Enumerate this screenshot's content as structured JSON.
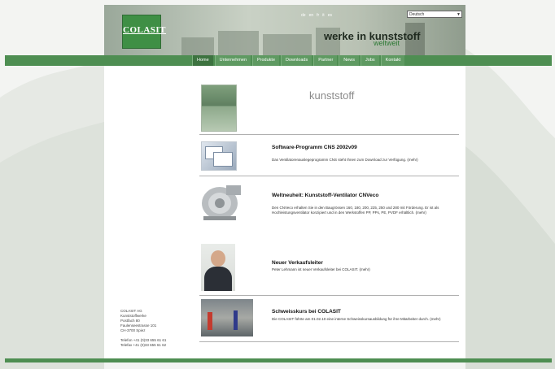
{
  "header": {
    "logo_text": "COLASIT",
    "tagline": "werke in kunststoff",
    "tagline_sub": "weltweit",
    "lang_links": [
      "de",
      "en",
      "fr",
      "it",
      "es"
    ],
    "language_select": "Deutsch"
  },
  "nav": {
    "items": [
      "Home",
      "Unternehmen",
      "Produkte",
      "Downloads",
      "Partner",
      "News",
      "Jobs",
      "Kontakt"
    ],
    "active_index": 0
  },
  "main": {
    "heading": "kunststoff",
    "items": [
      {
        "title": "Software-Programm CNS 2002v09",
        "text": "Das Ventilatorenauslegeprogramm CNS steht Ihnen zum Download zur Verfügung. (mehr)"
      },
      {
        "title": "Weltneuheit: Kunststoff-Ventilator CNVeco",
        "text": "Den CNVeco erhalten Sie in den Baugrössen 160, 180, 200, 225, 250 und 280 mit Förderung. Er ist als Hochleistungsventilator konzipiert und in den Werkstoffen PP, PPs, PE, PVDF erhältlich. (mehr)"
      },
      {
        "title": "Neuer Verkaufsleiter",
        "text": "Peter Lehmann ist neuer Verkaufsleiter bei COLASIT. (mehr)"
      },
      {
        "title": "Schweisskurs bei COLASIT",
        "text": "Die COLASIT führte am 01.02.10 eine interne Schweisskursausbildung für ihre Mitarbeiter durch. (mehr)"
      }
    ]
  },
  "address": {
    "lines": [
      "COLASIT AG",
      "Kunststoffwerke",
      "Postfach 80",
      "Faulenseestrasse 101",
      "CH-3700 Spiez",
      "",
      "Telefon +41 (0)33 655 61 61",
      "Telefax +41 (0)33 655 61 62"
    ]
  },
  "colors": {
    "brand_green": "#4e8e52",
    "logo_green": "#3f8f45"
  }
}
